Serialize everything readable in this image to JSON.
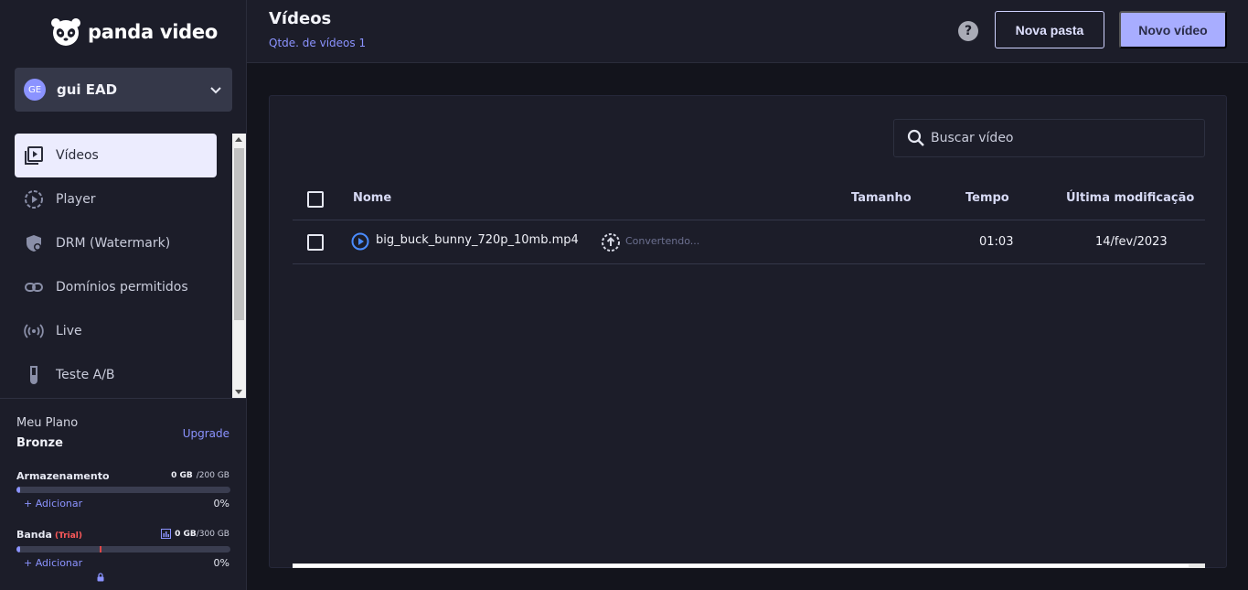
{
  "app": {
    "brand": "panda video"
  },
  "account": {
    "initials": "GE",
    "name": "gui EAD"
  },
  "sidebar": {
    "items": [
      {
        "label": "Vídeos",
        "icon": "video-library-icon",
        "active": true
      },
      {
        "label": "Player",
        "icon": "play-circle-icon",
        "active": false
      },
      {
        "label": "DRM (Watermark)",
        "icon": "shield-drm-icon",
        "active": false
      },
      {
        "label": "Domínios permitidos",
        "icon": "link-icon",
        "active": false
      },
      {
        "label": "Live",
        "icon": "broadcast-icon",
        "active": false
      },
      {
        "label": "Teste A/B",
        "icon": "test-tube-icon",
        "active": false
      }
    ]
  },
  "plan": {
    "label": "Meu Plano",
    "name": "Bronze",
    "upgrade": "Upgrade",
    "storage": {
      "title": "Armazenamento",
      "used": "0 GB",
      "total": "/200 GB",
      "add": "+ Adicionar",
      "percent": "0%",
      "fill_percent": 1
    },
    "bandwidth": {
      "title": "Banda",
      "badge": "(Trial)",
      "used": "0 GB",
      "total": "/300 GB",
      "add": "+ Adicionar",
      "percent": "0%",
      "fill_percent": 1,
      "trial_limit_percent": 39
    }
  },
  "header": {
    "title": "Vídeos",
    "count_label": "Qtde. de vídeos 1",
    "new_folder": "Nova pasta",
    "new_video": "Novo vídeo",
    "help": "?"
  },
  "search": {
    "placeholder": "Buscar vídeo"
  },
  "table": {
    "columns": {
      "name": "Nome",
      "size": "Tamanho",
      "time": "Tempo",
      "modified": "Última modificação"
    },
    "rows": [
      {
        "name": "big_buck_bunny_720p_10mb.mp4",
        "status": "Convertendo...",
        "size": "",
        "time": "01:03",
        "modified": "14/fev/2023"
      }
    ]
  },
  "colors": {
    "accent": "#8b93ff",
    "primary_button": "#a8adff",
    "sidebar_bg": "#1c1d29",
    "page_bg": "#13141c",
    "trial": "#ff5a5a"
  }
}
